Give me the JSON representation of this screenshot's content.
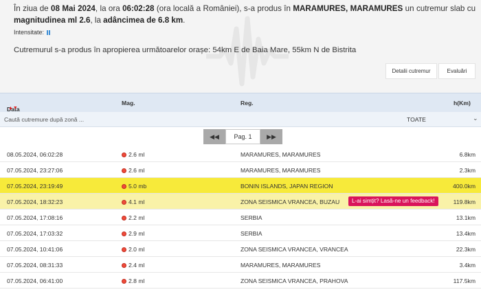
{
  "summary": {
    "p1": "În ziua de ",
    "date": "08 Mai 2024",
    "p2": ", la ora ",
    "time": "06:02:28",
    "p3": " (ora locală a României), s-a produs în ",
    "place": "MARAMURES, MARAMURES",
    "p4": " un cutremur slab cu ",
    "magnitude": "magnitudinea ml 2.6",
    "p5": ", la ",
    "depth": "adâncimea de 6.8 km",
    "p6": "."
  },
  "intensity_label": "Intensitate:",
  "nearby_text": "Cutremurul s-a produs în apropierea următoarelor orașe: 54km E de Baia Mare, 55km N de Bistrita",
  "buttons": {
    "details": "Detalii cutremur",
    "reviews": "Evaluări"
  },
  "table": {
    "headers": {
      "date": "Data",
      "mag": "Mag.",
      "reg": "Reg.",
      "depth": "h(Km)"
    },
    "filter_placeholder": "Caută cutremure după zonă ...",
    "filter_value": "TOATE",
    "page_label": "Pag. 1",
    "feedback_label": "L-ai simțit? Lasă-ne un feedback!",
    "rows": [
      {
        "date": "08.05.2024, 06:02:28",
        "mag": "2.6 ml",
        "reg": "MARAMURES, MARAMURES",
        "depth": "6.8km"
      },
      {
        "date": "07.05.2024, 23:27:06",
        "mag": "2.6 ml",
        "reg": "MARAMURES, MARAMURES",
        "depth": "2.3km"
      },
      {
        "date": "07.05.2024, 23:19:49",
        "mag": "5.0 mb",
        "reg": "BONIN ISLANDS, JAPAN REGION",
        "depth": "400.0km"
      },
      {
        "date": "07.05.2024, 18:32:23",
        "mag": "4.1 ml",
        "reg": "ZONA SEISMICA VRANCEA, BUZAU",
        "depth": "119.8km"
      },
      {
        "date": "07.05.2024, 17:08:16",
        "mag": "2.2 ml",
        "reg": "SERBIA",
        "depth": "13.1km"
      },
      {
        "date": "07.05.2024, 17:03:32",
        "mag": "2.9 ml",
        "reg": "SERBIA",
        "depth": "13.4km"
      },
      {
        "date": "07.05.2024, 10:41:06",
        "mag": "2.0 ml",
        "reg": "ZONA SEISMICA VRANCEA, VRANCEA",
        "depth": "22.3km"
      },
      {
        "date": "07.05.2024, 08:31:33",
        "mag": "2.4 ml",
        "reg": "MARAMURES, MARAMURES",
        "depth": "3.4km"
      },
      {
        "date": "07.05.2024, 06:41:00",
        "mag": "2.8 ml",
        "reg": "ZONA SEISMICA VRANCEA, PRAHOVA",
        "depth": "117.5km"
      }
    ]
  }
}
